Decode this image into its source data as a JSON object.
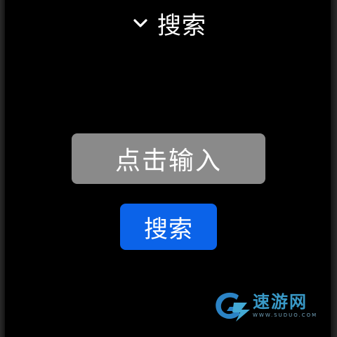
{
  "header": {
    "title": "搜索",
    "chevron_icon": "chevron-down-icon"
  },
  "search_input": {
    "placeholder": "点击输入"
  },
  "search_button": {
    "label": "搜索"
  },
  "watermark": {
    "name": "速游网",
    "url": "WWW.SUDUO.COM"
  },
  "colors": {
    "background": "#000000",
    "input_background": "#8a8a8a",
    "button_background": "#0b63e9",
    "text": "#ffffff",
    "watermark_accent": "#3ea7d8"
  }
}
